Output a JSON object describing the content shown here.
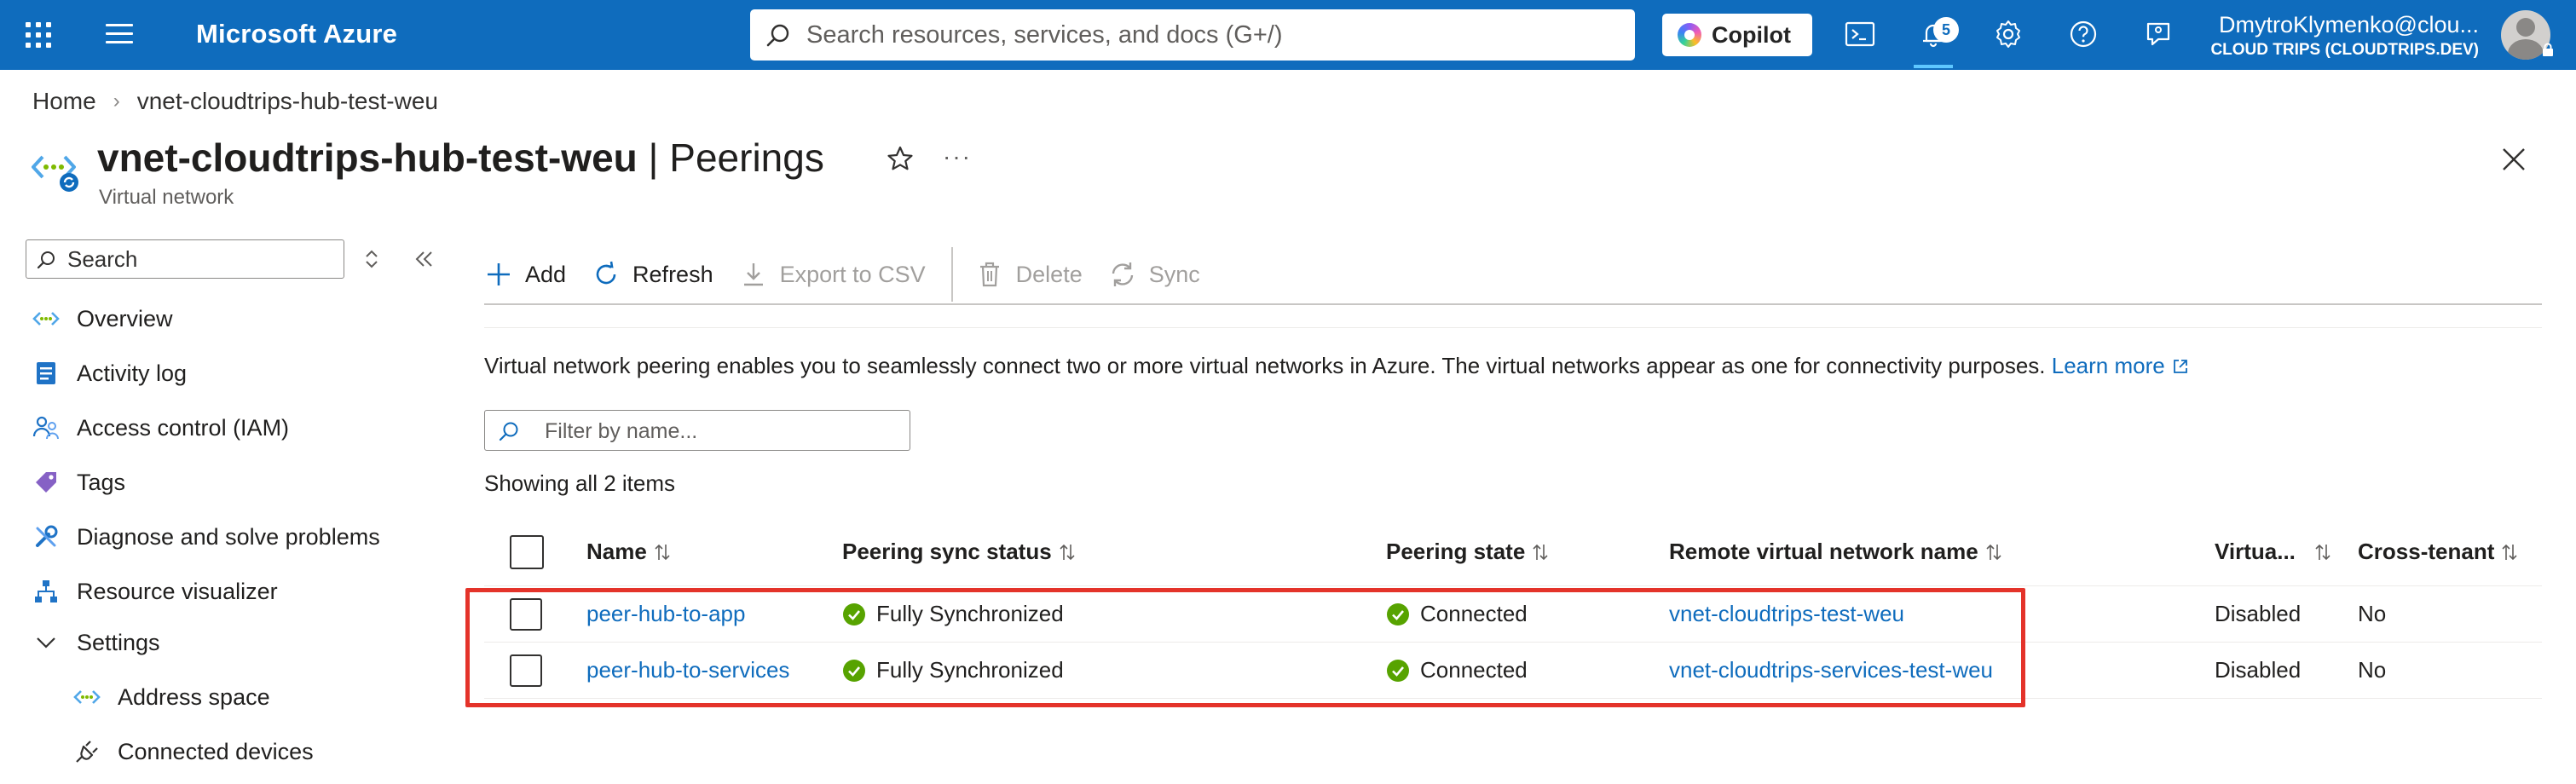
{
  "topbar": {
    "brand": "Microsoft Azure",
    "search_placeholder": "Search resources, services, and docs (G+/)",
    "copilot_label": "Copilot",
    "notification_count": "5",
    "user_name": "DmytroKlymenko@clou...",
    "user_org": "CLOUD TRIPS (CLOUDTRIPS.DEV)"
  },
  "breadcrumb": {
    "home": "Home",
    "current": "vnet-cloudtrips-hub-test-weu"
  },
  "header": {
    "resource_name": "vnet-cloudtrips-hub-test-weu",
    "separator": " | ",
    "blade_name": "Peerings",
    "subtitle": "Virtual network",
    "more_label": "···"
  },
  "nav": {
    "search_placeholder": "Search",
    "items": [
      {
        "label": "Overview",
        "icon": "vnet-icon"
      },
      {
        "label": "Activity log",
        "icon": "activity-log-icon"
      },
      {
        "label": "Access control (IAM)",
        "icon": "iam-icon"
      },
      {
        "label": "Tags",
        "icon": "tag-icon"
      },
      {
        "label": "Diagnose and solve problems",
        "icon": "wrench-icon"
      },
      {
        "label": "Resource visualizer",
        "icon": "visualizer-icon"
      },
      {
        "label": "Settings",
        "icon": "chevron-down-icon"
      },
      {
        "label": "Address space",
        "icon": "vnet-icon"
      },
      {
        "label": "Connected devices",
        "icon": "plug-icon"
      }
    ]
  },
  "commands": {
    "add": "Add",
    "refresh": "Refresh",
    "export": "Export to CSV",
    "delete": "Delete",
    "sync": "Sync"
  },
  "info": {
    "text": "Virtual network peering enables you to seamlessly connect two or more virtual networks in Azure. The virtual networks appear as one for connectivity purposes. ",
    "link": "Learn more"
  },
  "filter": {
    "placeholder": "Filter by name..."
  },
  "count_text": "Showing all 2 items",
  "table": {
    "columns": [
      "Name",
      "Peering sync status",
      "Peering state",
      "Remote virtual network name",
      "Virtua...",
      "Cross-tenant"
    ],
    "rows": [
      {
        "name": "peer-hub-to-app",
        "sync_status": "Fully Synchronized",
        "state": "Connected",
        "remote": "vnet-cloudtrips-test-weu",
        "virtual": "Disabled",
        "cross_tenant": "No"
      },
      {
        "name": "peer-hub-to-services",
        "sync_status": "Fully Synchronized",
        "state": "Connected",
        "remote": "vnet-cloudtrips-services-test-weu",
        "virtual": "Disabled",
        "cross_tenant": "No"
      }
    ]
  },
  "colors": {
    "azure_blue": "#0f6cbd",
    "success_green": "#57a300",
    "highlight_red": "#e4332a"
  }
}
